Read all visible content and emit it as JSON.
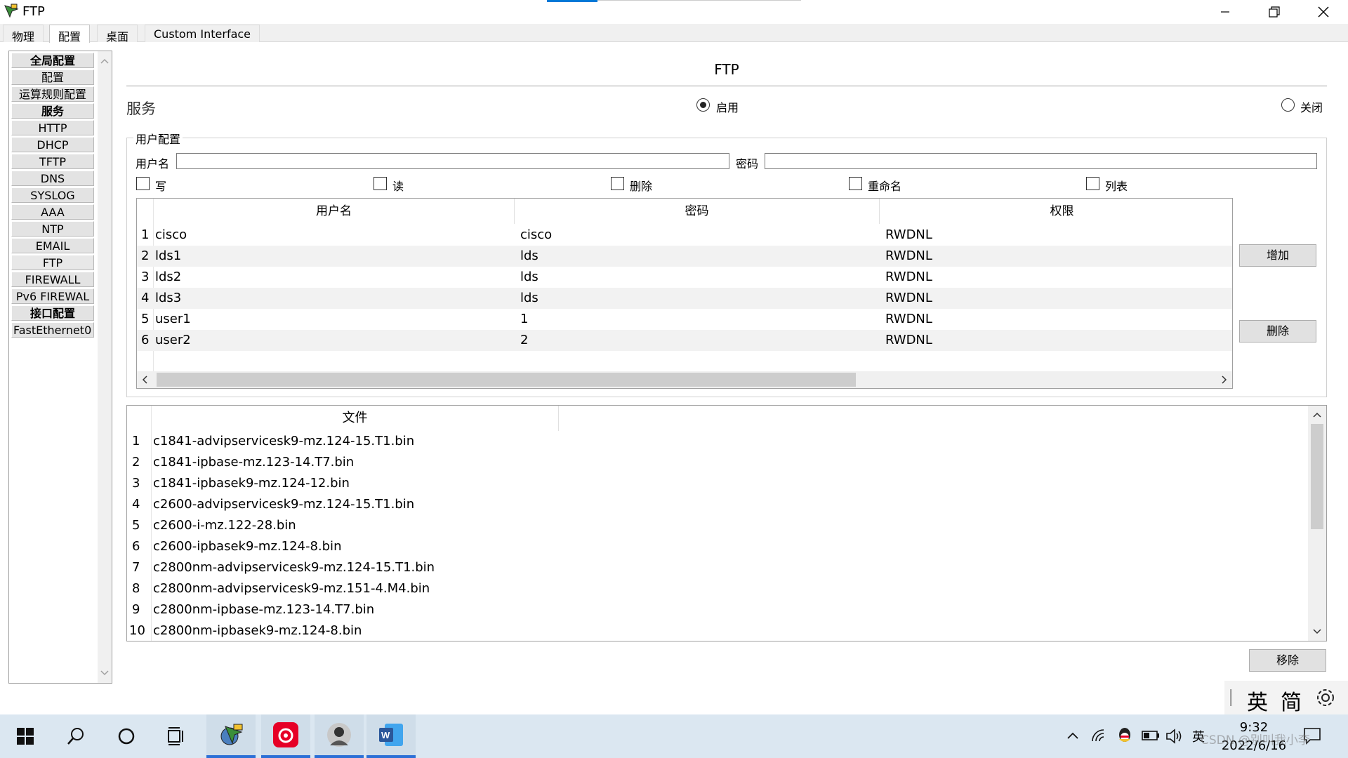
{
  "window": {
    "title": "FTP"
  },
  "tabs": [
    "物理",
    "配置",
    "桌面",
    "Custom Interface"
  ],
  "sidebar": {
    "items": [
      "全局配置",
      "配置",
      "运算规则配置",
      "服务",
      "HTTP",
      "DHCP",
      "TFTP",
      "DNS",
      "SYSLOG",
      "AAA",
      "NTP",
      "EMAIL",
      "FTP",
      "FIREWALL",
      "Pv6 FIREWAL",
      "接口配置",
      "FastEthernet0"
    ]
  },
  "main": {
    "title": "FTP",
    "service_label": "服务",
    "radio_on": "启用",
    "radio_off": "关闭",
    "group_title": "用户配置",
    "username_label": "用户名",
    "password_label": "密码",
    "username_value": "",
    "password_value": "",
    "perms": [
      "写",
      "读",
      "删除",
      "重命名",
      "列表"
    ],
    "user_columns": [
      "用户名",
      "密码",
      "权限"
    ],
    "users": [
      {
        "n": "1",
        "user": "cisco",
        "pass": "cisco",
        "perm": "RWDNL"
      },
      {
        "n": "2",
        "user": "lds1",
        "pass": "lds",
        "perm": "RWDNL"
      },
      {
        "n": "3",
        "user": "lds2",
        "pass": "lds",
        "perm": "RWDNL"
      },
      {
        "n": "4",
        "user": "lds3",
        "pass": "lds",
        "perm": "RWDNL"
      },
      {
        "n": "5",
        "user": "user1",
        "pass": "1",
        "perm": "RWDNL"
      },
      {
        "n": "6",
        "user": "user2",
        "pass": "2",
        "perm": "RWDNL"
      }
    ],
    "add_button": "增加",
    "delete_button": "删除",
    "file_column": "文件",
    "files": [
      {
        "n": "1",
        "name": "c1841-advipservicesk9-mz.124-15.T1.bin"
      },
      {
        "n": "2",
        "name": "c1841-ipbase-mz.123-14.T7.bin"
      },
      {
        "n": "3",
        "name": "c1841-ipbasek9-mz.124-12.bin"
      },
      {
        "n": "4",
        "name": "c2600-advipservicesk9-mz.124-15.T1.bin"
      },
      {
        "n": "5",
        "name": "c2600-i-mz.122-28.bin"
      },
      {
        "n": "6",
        "name": "c2600-ipbasek9-mz.124-8.bin"
      },
      {
        "n": "7",
        "name": "c2800nm-advipservicesk9-mz.124-15.T1.bin"
      },
      {
        "n": "8",
        "name": "c2800nm-advipservicesk9-mz.151-4.M4.bin"
      },
      {
        "n": "9",
        "name": "c2800nm-ipbase-mz.123-14.T7.bin"
      },
      {
        "n": "10",
        "name": "c2800nm-ipbasek9-mz.124-8.bin"
      }
    ],
    "remove_button": "移除"
  },
  "ime": {
    "lang": "英",
    "mode": "简"
  },
  "taskbar": {
    "tray_lang": "英",
    "time": "9:32",
    "date": "2022/6/16"
  },
  "watermark": "CSDN @别叫我小李",
  "colors": {
    "accent": "#0078d7",
    "taskbar": "#dbe7f1",
    "netease": "#e60026",
    "word": "#2b579a"
  }
}
